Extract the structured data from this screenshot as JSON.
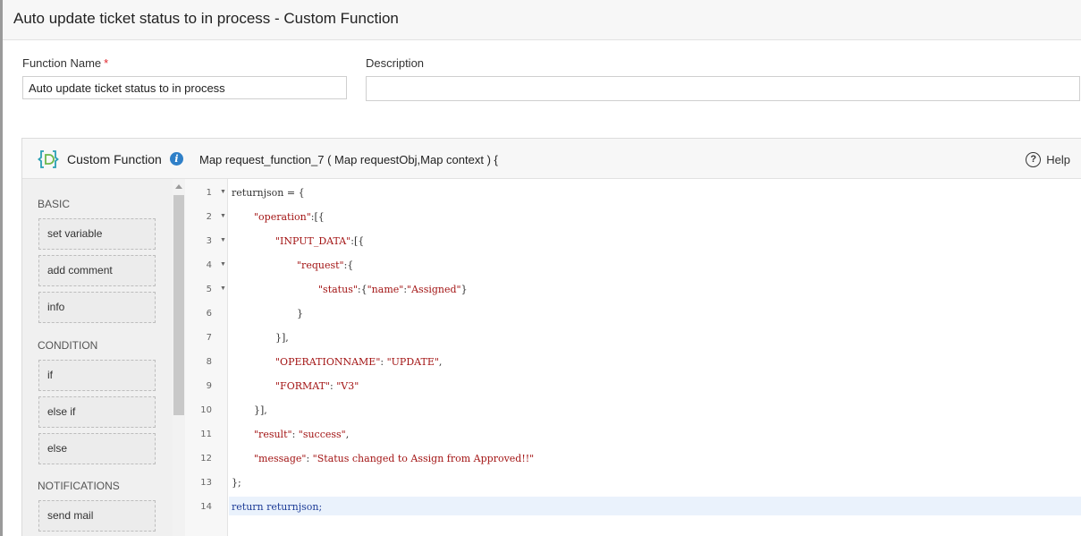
{
  "page": {
    "title": "Auto update ticket status to in process - Custom Function"
  },
  "form": {
    "function_name": {
      "label": "Function Name",
      "required_mark": "*",
      "value": "Auto update ticket status to in process"
    },
    "description": {
      "label": "Description",
      "value": ""
    }
  },
  "editor": {
    "title": "Custom Function",
    "signature": "Map request_function_7 ( Map requestObj,Map context ) {",
    "help_label": "Help",
    "palette": {
      "sections": [
        {
          "title": "BASIC",
          "items": [
            "set variable",
            "add comment",
            "info"
          ]
        },
        {
          "title": "CONDITION",
          "items": [
            "if",
            "else if",
            "else"
          ]
        },
        {
          "title": "NOTIFICATIONS",
          "items": [
            "send mail"
          ]
        }
      ]
    },
    "lines": [
      {
        "num": "1",
        "fold": true
      },
      {
        "num": "2",
        "fold": true
      },
      {
        "num": "3",
        "fold": true
      },
      {
        "num": "4",
        "fold": true
      },
      {
        "num": "5",
        "fold": true
      },
      {
        "num": "6",
        "fold": false
      },
      {
        "num": "7",
        "fold": false
      },
      {
        "num": "8",
        "fold": false
      },
      {
        "num": "9",
        "fold": false
      },
      {
        "num": "10",
        "fold": false
      },
      {
        "num": "11",
        "fold": false
      },
      {
        "num": "12",
        "fold": false
      },
      {
        "num": "13",
        "fold": false
      },
      {
        "num": "14",
        "fold": false
      }
    ],
    "code": {
      "l1": "returnjson = {",
      "l2_key": "\"operation\"",
      "l2_rest": ":[{",
      "l3_key": "\"INPUT_DATA\"",
      "l3_rest": ":[{",
      "l4_key": "\"request\"",
      "l4_rest": ":{",
      "l5_key": "\"status\"",
      "l5_mid1": ":{",
      "l5_key2": "\"name\"",
      "l5_mid2": ":",
      "l5_val": "\"Assigned\"",
      "l5_end": "}",
      "l6": "}",
      "l7": "}],",
      "l8_key": "\"OPERATIONNAME\"",
      "l8_mid": ": ",
      "l8_val": "\"UPDATE\"",
      "l8_end": ",",
      "l9_key": "\"FORMAT\"",
      "l9_mid": ": ",
      "l9_val": "\"V3\"",
      "l10": "}],",
      "l11_key": "\"result\"",
      "l11_mid": ": ",
      "l11_val": "\"success\"",
      "l11_end": ",",
      "l12_key": "\"message\"",
      "l12_mid": ": ",
      "l12_val": "\"Status changed to Assign from Approved!!\"",
      "l13": "};",
      "l14": "return returnjson;"
    },
    "active_line": "14"
  }
}
